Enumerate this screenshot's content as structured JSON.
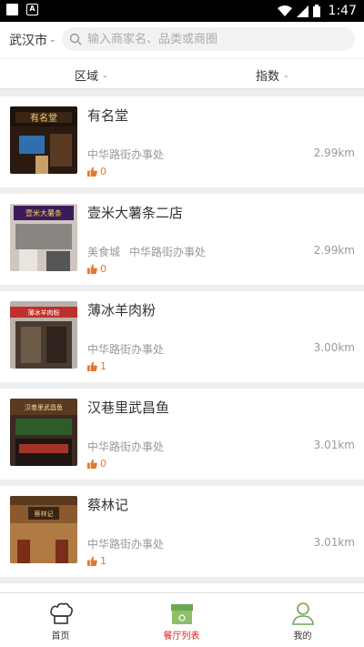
{
  "status_bar": {
    "time": "1:47",
    "icons": [
      "square-icon",
      "a-icon",
      "wifi-icon",
      "signal-icon",
      "battery-icon"
    ]
  },
  "header": {
    "city": "武汉市",
    "search_placeholder": "输入商家名、品类或商圈"
  },
  "filters": [
    "区域",
    "指数"
  ],
  "restaurants": [
    {
      "name": "有名堂",
      "area": "",
      "addr": "中华路街办事处",
      "distance": "2.99km",
      "likes": "0"
    },
    {
      "name": "壹米大薯条二店",
      "area": "美食城",
      "addr": "中华路街办事处",
      "distance": "2.99km",
      "likes": "0"
    },
    {
      "name": "薄冰羊肉粉",
      "area": "",
      "addr": "中华路街办事处",
      "distance": "3.00km",
      "likes": "1"
    },
    {
      "name": "汉巷里武昌鱼",
      "area": "",
      "addr": "中华路街办事处",
      "distance": "3.01km",
      "likes": "0"
    },
    {
      "name": "蔡林记",
      "area": "",
      "addr": "中华路街办事处",
      "distance": "3.01km",
      "likes": "1"
    }
  ],
  "tabs": [
    {
      "label": "首页",
      "icon": "chef-hat-icon",
      "active": false
    },
    {
      "label": "餐厅列表",
      "icon": "storefront-icon",
      "active": true
    },
    {
      "label": "我的",
      "icon": "person-icon",
      "active": false
    }
  ],
  "colors": {
    "accent_red": "#d9261c",
    "like_orange": "#e8772e",
    "tab_green": "#6aa84f"
  }
}
